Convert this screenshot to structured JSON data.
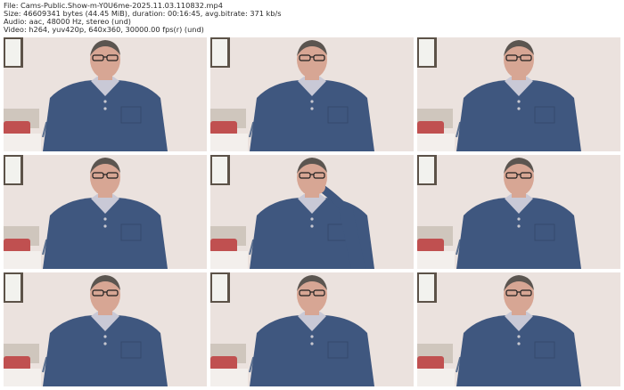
{
  "header": {
    "file_line": "File: Cams-Public.Show-m-Y0U6me-2025.11.03.110832.mp4",
    "size_line": "Size: 46609341 bytes (44.45 MiB), duration: 00:16:45, avg.bitrate: 371 kb/s",
    "audio_line": "Audio: aac, 48000 Hz, stereo (und)",
    "video_line": "Video: h264, yuv420p, 640x360, 30000.00 fps(r) (und)"
  },
  "colors": {
    "wall": "#ebe2de",
    "sweater": "#3f577f",
    "shirt": "#c9c9d6",
    "skin": "#d7a694",
    "hair": "#5b5550",
    "frame_picture": "#f2f2ee",
    "lamp": "#5a6f8f"
  },
  "thumbnails": [
    {
      "pose": "upright"
    },
    {
      "pose": "upright"
    },
    {
      "pose": "upright"
    },
    {
      "pose": "upright"
    },
    {
      "pose": "hand-on-chin"
    },
    {
      "pose": "upright"
    },
    {
      "pose": "upright"
    },
    {
      "pose": "upright"
    },
    {
      "pose": "upright"
    }
  ]
}
